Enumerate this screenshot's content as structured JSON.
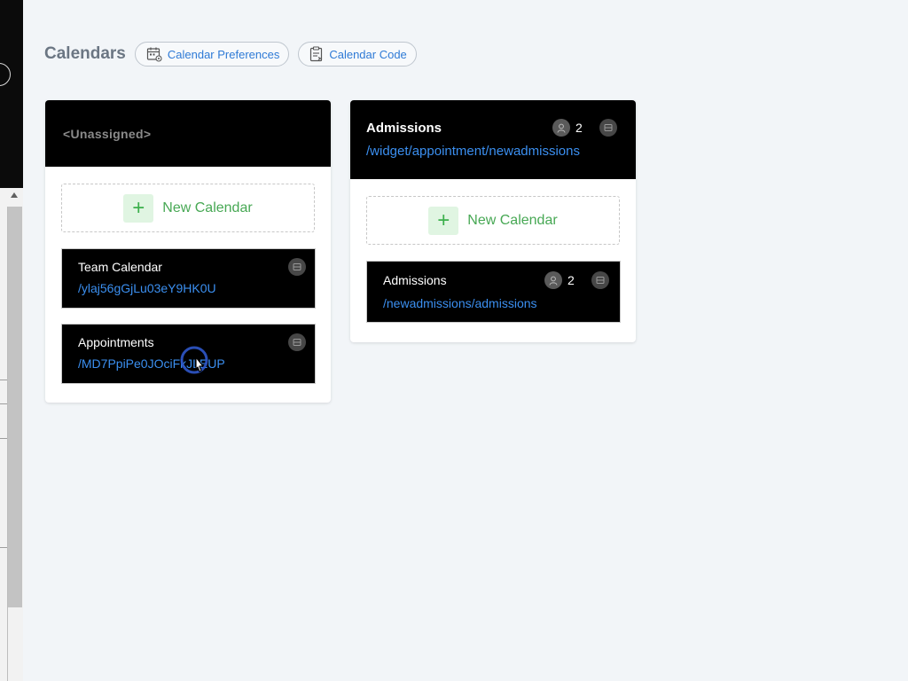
{
  "header": {
    "title": "Calendars",
    "preferences_label": "Calendar Preferences",
    "code_label": "Calendar Code"
  },
  "columns": [
    {
      "title": "<Unassigned>",
      "new_calendar_label": "New Calendar",
      "calendars": [
        {
          "name": "Team Calendar",
          "path": "/ylaj56gGjLu03eY9HK0U"
        },
        {
          "name": "Appointments",
          "path": "/MD7PpiPe0JOciFkJLEUP"
        }
      ]
    },
    {
      "title": "Admissions",
      "path": "/widget/appointment/newadmissions",
      "user_count": "2",
      "new_calendar_label": "New Calendar",
      "calendars": [
        {
          "name": "Admissions",
          "path": "/newadmissions/admissions",
          "user_count": "2"
        }
      ]
    }
  ],
  "icons": {
    "preferences": "calendar-settings-icon",
    "code": "clipboard-code-icon",
    "users": "user-icon",
    "menu": "card-menu-icon",
    "add": "plus-icon"
  },
  "colors": {
    "accent_blue": "#2e7ad6",
    "link_blue": "#3b8ff0",
    "add_green": "#47a854",
    "card_bg": "#000000",
    "page_bg": "#f2f5f8"
  }
}
